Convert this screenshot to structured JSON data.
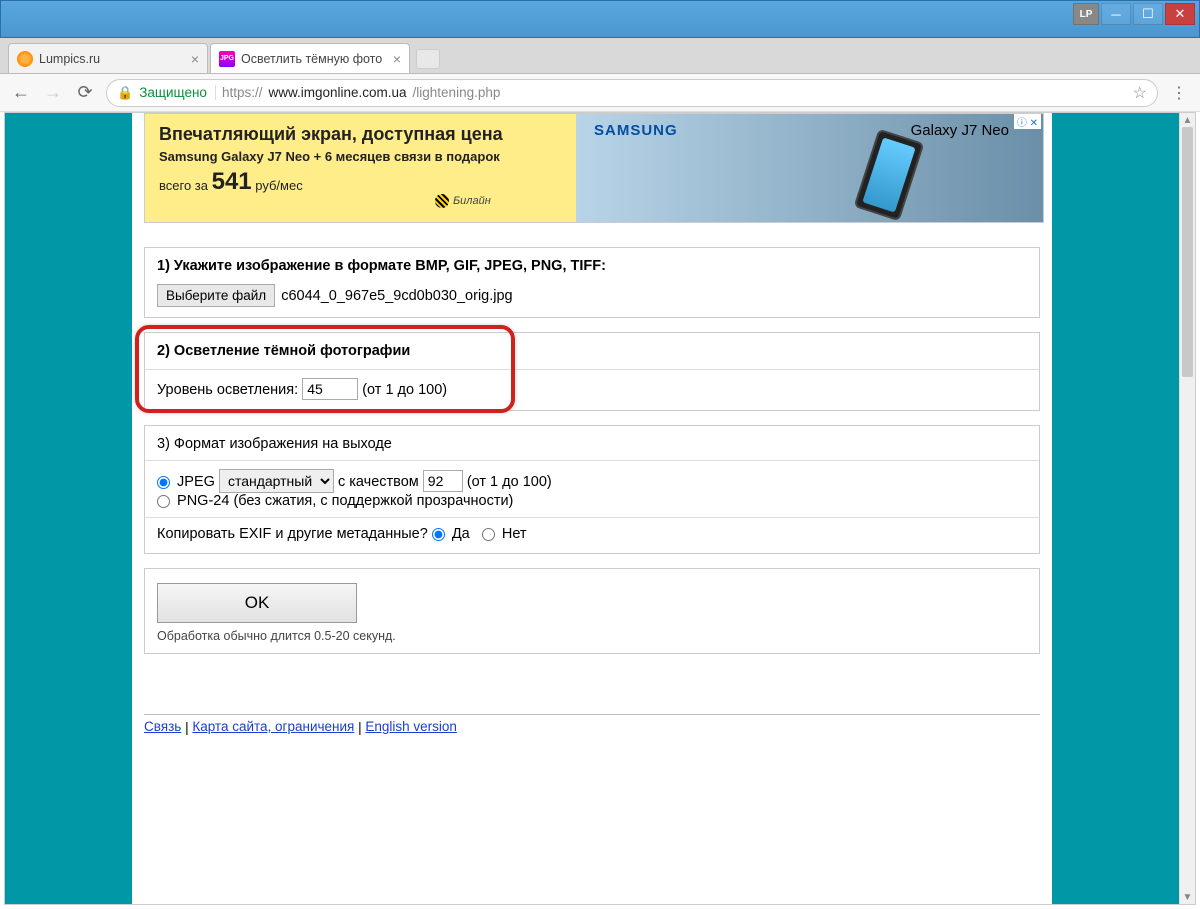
{
  "titlebar": {
    "lp": "LP"
  },
  "tabs": [
    {
      "title": "Lumpics.ru",
      "icon": "orange"
    },
    {
      "title": "Осветлить тёмную фото",
      "icon": "jpg",
      "active": true
    }
  ],
  "address": {
    "secure_label": "Защищено",
    "protocol": "https://",
    "host": "www.imgonline.com.ua",
    "path": "/lightening.php"
  },
  "ad": {
    "headline": "Впечатляющий экран, доступная цена",
    "sub": "Samsung Galaxy J7 Neo + 6 месяцев связи в подарок",
    "price_prefix": "всего за ",
    "price_value": "541",
    "price_suffix": " руб/мес",
    "brand": "SAMSUNG",
    "model": "Galaxy J7 Neo",
    "carrier": "Билайн",
    "adchoice": "ⓘ ✕"
  },
  "step1": {
    "title": "1) Укажите изображение в формате BMP, GIF, JPEG, PNG, TIFF:",
    "button": "Выберите файл",
    "filename": "c6044_0_967e5_9cd0b030_orig.jpg"
  },
  "step2": {
    "title": "2) Осветление тёмной фотографии",
    "level_label": "Уровень осветления:",
    "level_value": "45",
    "level_hint": "(от 1 до 100)"
  },
  "step3": {
    "title": "3) Формат изображения на выходе",
    "jpeg_label": "JPEG",
    "jpeg_select": "стандартный",
    "quality_label": " с качеством ",
    "quality_value": "92",
    "quality_hint": " (от 1 до 100)",
    "png_label": "PNG-24 (без сжатия, с поддержкой прозрачности)",
    "exif_label": "Копировать EXIF и другие метаданные? ",
    "yes": "Да",
    "no": "Нет"
  },
  "submit": {
    "ok": "OK",
    "note": "Обработка обычно длится 0.5-20 секунд."
  },
  "footer": {
    "link1": "Связь",
    "link2": "Карта сайта, ограничения",
    "link3": "English version",
    "sep": " | "
  }
}
